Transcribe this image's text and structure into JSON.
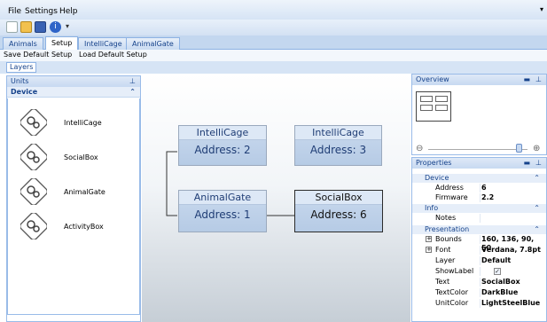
{
  "menubar": {
    "items": [
      "File",
      "Settings",
      "Help"
    ]
  },
  "toolbar": {
    "icons": [
      "new-file-icon",
      "open-folder-icon",
      "save-icon",
      "info-icon",
      "dropdown-icon"
    ]
  },
  "tabs": [
    "Animals",
    "Setup",
    "IntelliCage",
    "AnimalGate"
  ],
  "setup_actions": {
    "save": "Save Default Setup",
    "load": "Load Default Setup"
  },
  "layers_label": "Layers",
  "units_panel": {
    "title": "Units",
    "category": "Device",
    "items": [
      "IntelliCage",
      "SocialBox",
      "AnimalGate",
      "ActivityBox"
    ]
  },
  "canvas": {
    "nodes": [
      {
        "title": "IntelliCage",
        "address": "Address: 2"
      },
      {
        "title": "IntelliCage",
        "address": "Address: 3"
      },
      {
        "title": "AnimalGate",
        "address": "Address: 1"
      },
      {
        "title": "SocialBox",
        "address": "Address: 6"
      }
    ]
  },
  "overview": {
    "title": "Overview"
  },
  "properties": {
    "title": "Properties",
    "categories": {
      "device": "Device",
      "info": "Info",
      "presentation": "Presentation"
    },
    "rows": {
      "address": {
        "name": "Address",
        "value": "6"
      },
      "firmware": {
        "name": "Firmware",
        "value": "2.2"
      },
      "notes": {
        "name": "Notes",
        "value": ""
      },
      "bounds": {
        "name": "Bounds",
        "value": "160, 136, 90, 50"
      },
      "font": {
        "name": "Font",
        "value": "Verdana, 7.8pt"
      },
      "layer": {
        "name": "Layer",
        "value": "Default"
      },
      "showlabel": {
        "name": "ShowLabel",
        "value": "checked"
      },
      "text": {
        "name": "Text",
        "value": "SocialBox"
      },
      "textcolor": {
        "name": "TextColor",
        "value": "DarkBlue"
      },
      "unitcolor": {
        "name": "UnitColor",
        "value": "LightSteelBlue"
      }
    }
  }
}
